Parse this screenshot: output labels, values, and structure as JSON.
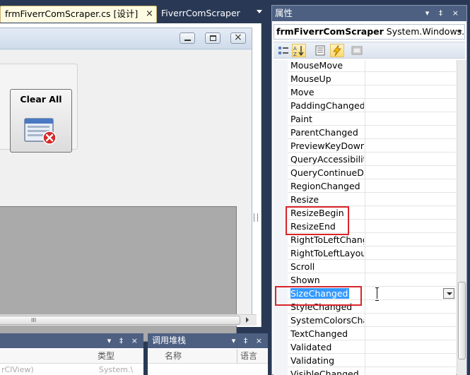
{
  "document_tabs": {
    "active": {
      "label": "frmFiverrComScraper.cs [设计]",
      "close_glyph": "×"
    },
    "other": {
      "label": "FiverrComScraper"
    }
  },
  "designer": {
    "form": {
      "caption_buttons": {
        "minimize": "minimize-icon",
        "maximize": "maximize-icon",
        "close": "×"
      },
      "clear_all_button": {
        "label": "Clear All",
        "icon": "clear-window-icon"
      },
      "hscroll_grip": "III"
    }
  },
  "bottom_panels": {
    "left": {
      "title": "",
      "type_header": "类型",
      "faint_row_left": "rClView)",
      "faint_row_right": "System.\\"
    },
    "right": {
      "title": "调用堆栈",
      "name_header": "名称",
      "lang_header": "语言"
    },
    "controls": "▾ ‡ ×"
  },
  "properties": {
    "title": "属性",
    "title_controls": "▾ ‡ ×",
    "object_name": "frmFiverrComScraper",
    "object_type": "System.Windows.Forms.Form",
    "toolbar": [
      "categorized-icon",
      "alphabetical-icon",
      "properties-icon",
      "events-icon",
      "property-pages-icon"
    ],
    "toolbar_active_index": 4,
    "events": [
      "MouseMove",
      "MouseUp",
      "Move",
      "PaddingChanged",
      "Paint",
      "ParentChanged",
      "PreviewKeyDown",
      "QueryAccessibilityHelp",
      "QueryContinueDrag",
      "RegionChanged",
      "Resize",
      "ResizeBegin",
      "ResizeEnd",
      "RightToLeftChanged",
      "RightToLeftLayoutChanged",
      "Scroll",
      "Shown",
      "SizeChanged",
      "StyleChanged",
      "SystemColorsChanged",
      "TextChanged",
      "Validated",
      "Validating",
      "VisibleChanged"
    ],
    "selected_event": "SizeChanged",
    "highlighted_events": [
      "ResizeBegin",
      "ResizeEnd",
      "SizeChanged"
    ],
    "highlight_color": "#d9252a",
    "selection_color": "#3399ff"
  }
}
